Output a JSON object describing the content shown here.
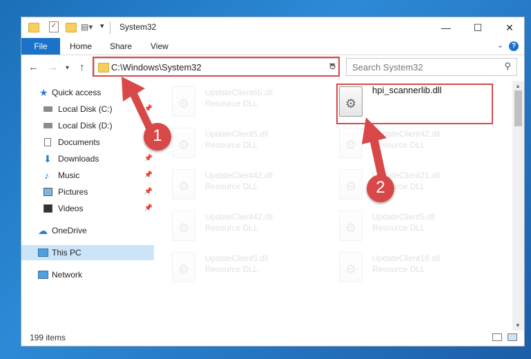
{
  "window": {
    "title": "System32",
    "controls": {
      "minimize": "—",
      "maximize": "☐",
      "close": "✕"
    }
  },
  "ribbon": {
    "file_tab": "File",
    "tabs": [
      "Home",
      "Share",
      "View"
    ],
    "help": "?"
  },
  "nav": {
    "address": "C:\\Windows\\System32",
    "search_placeholder": "Search System32"
  },
  "sidebar": {
    "items": [
      {
        "label": "Quick access",
        "icon": "star-icon",
        "pinned": false
      },
      {
        "label": "Local Disk (C:)",
        "icon": "drive-icon",
        "pinned": true
      },
      {
        "label": "Local Disk (D:)",
        "icon": "drive-icon",
        "pinned": false
      },
      {
        "label": "Documents",
        "icon": "documents-icon",
        "pinned": true
      },
      {
        "label": "Downloads",
        "icon": "downloads-icon",
        "pinned": true
      },
      {
        "label": "Music",
        "icon": "music-icon",
        "pinned": true
      },
      {
        "label": "Pictures",
        "icon": "pictures-icon",
        "pinned": true
      },
      {
        "label": "Videos",
        "icon": "videos-icon",
        "pinned": true
      },
      {
        "label": "OneDrive",
        "icon": "cloud-icon",
        "pinned": false
      },
      {
        "label": "This PC",
        "icon": "computer-icon",
        "pinned": false,
        "selected": true
      },
      {
        "label": "Network",
        "icon": "network-icon",
        "pinned": false
      }
    ]
  },
  "files": {
    "left": [
      {
        "name": "UpdateClient65.dll",
        "type": "Resource DLL"
      },
      {
        "name": "UpdateClient5.dll",
        "type": "Resource DLL"
      },
      {
        "name": "UpdateClient42.dll",
        "type": "Resource DLL"
      },
      {
        "name": "UpdateClient42.dll",
        "type": "Resource DLL"
      },
      {
        "name": "UpdateClient5.dll",
        "type": "Resource DLL"
      }
    ],
    "right": [
      {
        "name": "hpi_scannerlib.dll",
        "type": ""
      },
      {
        "name": "UpdateClient42.dll",
        "type": "Resource DLL"
      },
      {
        "name": "UpdateClient21.dll",
        "type": "Resource DLL"
      },
      {
        "name": "UpdateClient5.dll",
        "type": "Resource DLL"
      },
      {
        "name": "UpdateClient19.dll",
        "type": "Resource DLL"
      }
    ]
  },
  "status": {
    "item_count": "199 items"
  },
  "annotations": {
    "step1": "1",
    "step2": "2"
  },
  "colors": {
    "accent": "#1a73c8",
    "annotation": "#d94848",
    "selected": "#cce4f7"
  }
}
